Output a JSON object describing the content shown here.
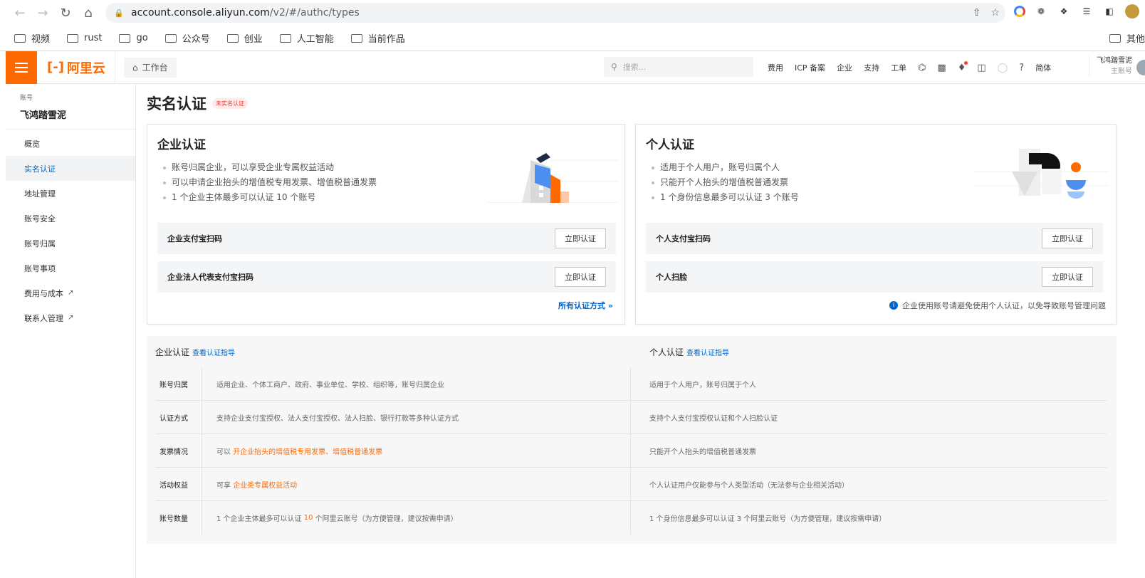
{
  "browser": {
    "url_host": "account.console.aliyun.com",
    "url_path": "/v2/#/authc/types",
    "bookmarks": [
      "视频",
      "rust",
      "go",
      "公众号",
      "创业",
      "人工智能",
      "当前作品"
    ],
    "bookmarks_other": "其他"
  },
  "topbar": {
    "logo": "阿里云",
    "workbench": "工作台",
    "search_placeholder": "搜索...",
    "nav": [
      "费用",
      "ICP 备案",
      "企业",
      "支持",
      "工单"
    ],
    "lang": "简体",
    "user_name": "飞鸿踏雪泥",
    "user_role": "主账号"
  },
  "sidebar": {
    "section": "账号",
    "account_name": "飞鸿踏雪泥",
    "items": [
      {
        "label": "概览"
      },
      {
        "label": "实名认证"
      },
      {
        "label": "地址管理"
      },
      {
        "label": "账号安全"
      },
      {
        "label": "账号归属"
      },
      {
        "label": "账号事项"
      },
      {
        "label": "费用与成本"
      },
      {
        "label": "联系人管理"
      }
    ]
  },
  "page": {
    "title": "实名认证",
    "status_badge": "未实名认证"
  },
  "enterprise": {
    "title": "企业认证",
    "bullets": [
      "账号归属企业，可以享受企业专属权益活动",
      "可以申请企业抬头的增值税专用发票、增值税普通发票",
      "1 个企业主体最多可以认证 10 个账号"
    ],
    "methods": [
      "企业支付宝扫码",
      "企业法人代表支付宝扫码"
    ],
    "verify_label": "立即认证",
    "all_methods": "所有认证方式"
  },
  "personal": {
    "title": "个人认证",
    "bullets": [
      "适用于个人用户，账号归属个人",
      "只能开个人抬头的增值税普通发票",
      "1 个身份信息最多可以认证 3 个账号"
    ],
    "methods": [
      "个人支付宝扫码",
      "个人扫脸"
    ],
    "verify_label": "立即认证",
    "note": "企业使用账号请避免使用个人认证，以免导致账号管理问题"
  },
  "compare": {
    "ent_head": "企业认证",
    "per_head": "个人认证",
    "guide_link": "查看认证指导",
    "rows": [
      {
        "label": "账号归属",
        "ent_pre": "适用企业、个体工商户、政府、事业单位、学校、组织等，账号归属企业",
        "ent_hl": "",
        "ent_post": "",
        "per": "适用于个人用户，账号归属于个人"
      },
      {
        "label": "认证方式",
        "ent_pre": "支持企业支付宝授权、法人支付宝授权、法人扫脸、银行打款等多种认证方式",
        "ent_hl": "",
        "ent_post": "",
        "per": "支持个人支付宝授权认证和个人扫脸认证"
      },
      {
        "label": "发票情况",
        "ent_pre": "可以 ",
        "ent_hl": "开企业抬头的增值税专用发票、增值税普通发票",
        "ent_post": "",
        "per": "只能开个人抬头的增值税普通发票"
      },
      {
        "label": "活动权益",
        "ent_pre": "可享 ",
        "ent_hl": "企业类专属权益活动",
        "ent_post": "",
        "per": "个人认证用户仅能参与个人类型活动（无法参与企业相关活动）"
      },
      {
        "label": "账号数量",
        "ent_pre": "1 个企业主体最多可以认证 ",
        "ent_hl": "10",
        "ent_post": " 个阿里云账号（为方便管理，建议按需申请）",
        "per": "1 个身份信息最多可以认证 3 个阿里云账号（为方便管理，建议按需申请）"
      }
    ]
  }
}
